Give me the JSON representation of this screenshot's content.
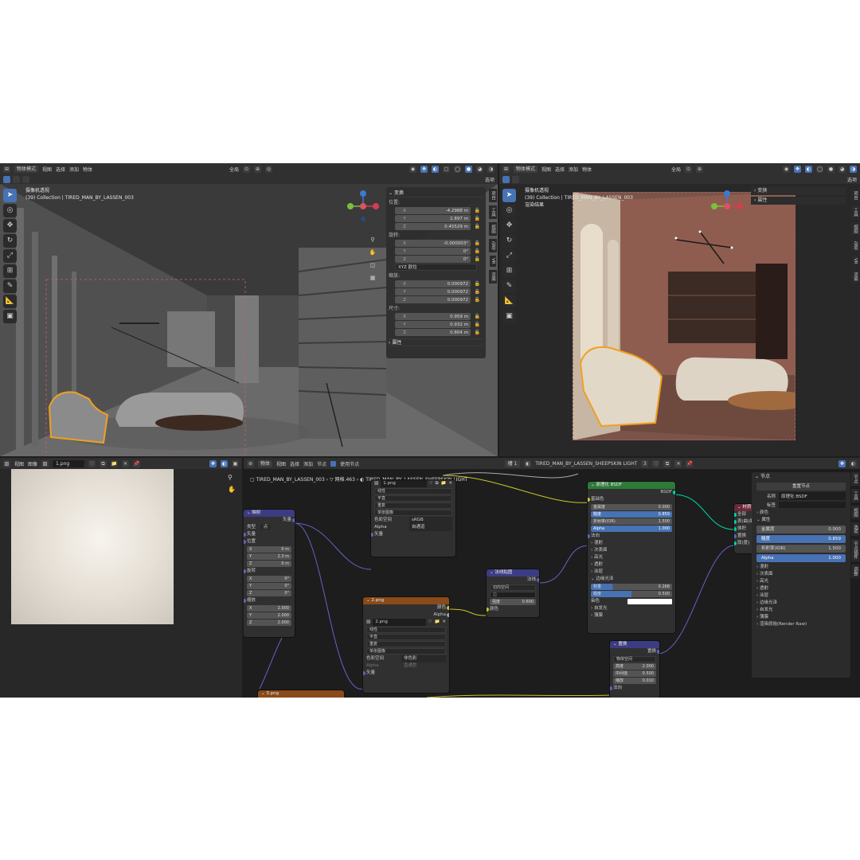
{
  "left_viewport": {
    "header": {
      "mode": "物体模式",
      "menus": [
        "视图",
        "选择",
        "添加",
        "物体"
      ],
      "transform_global": "全局",
      "options": "选项"
    },
    "info_line1": "摄像机透视",
    "info_line2": "(39) Collection | TIRED_MAN_BY_LASSEN_003"
  },
  "transform_panel": {
    "title": "变换",
    "location_label": "位置:",
    "location": [
      {
        "k": "X",
        "v": "-4.2988 m"
      },
      {
        "k": "Y",
        "v": "2.897 m"
      },
      {
        "k": "Z",
        "v": "0.45529 m"
      }
    ],
    "rotation_label": "旋转:",
    "rotation": [
      {
        "k": "X",
        "v": "-0.000003°"
      },
      {
        "k": "Y",
        "v": "0°"
      },
      {
        "k": "Z",
        "v": "0°"
      }
    ],
    "rotation_mode": "XYZ 欧拉",
    "scale_label": "缩放:",
    "scale": [
      {
        "k": "X",
        "v": "0.000972"
      },
      {
        "k": "Y",
        "v": "0.000972"
      },
      {
        "k": "Z",
        "v": "0.000972"
      }
    ],
    "dimensions_label": "尺寸:",
    "dimensions": [
      {
        "k": "X",
        "v": "0.959 m"
      },
      {
        "k": "Y",
        "v": "0.932 m"
      },
      {
        "k": "Z",
        "v": "0.804 m"
      }
    ],
    "properties": "属性"
  },
  "left_vtabs": [
    "项目",
    "工具",
    "视图",
    "杂项",
    "VR",
    "渲染"
  ],
  "right_viewport": {
    "header": {
      "mode": "物体模式",
      "menus": [
        "视图",
        "选择",
        "添加",
        "物体"
      ],
      "transform_global": "全局",
      "options": "选项"
    },
    "info_line1": "摄像机透视",
    "info_line2": "(39) Collection | TIRED_MAN_BY_LASSEN_003",
    "info_line3": "渲染结果",
    "panel_items": [
      "变换",
      "属性"
    ]
  },
  "right_vtabs": [
    "项目",
    "工具",
    "视图",
    "杂项",
    "VR",
    "渲染"
  ],
  "image_editor": {
    "menus": [
      "视图",
      "图像"
    ],
    "image_name": "1.png"
  },
  "node_editor": {
    "header": {
      "mode": "物体",
      "menus": [
        "视图",
        "选择",
        "添加",
        "节点"
      ],
      "use_nodes": "使用节点",
      "slot": "槽 1",
      "material": "TIRED_MAN_BY_LASSEN_SHEEPSKIN LIGHT",
      "users": "3"
    },
    "breadcrumb": [
      "TIRED_MAN_BY_LASSEN_003",
      "网格.463",
      "TIRED_MAN_BY_LASSEN_SHEEPSKIN LIGHT"
    ]
  },
  "mapping_node": {
    "title": "映射",
    "out": "矢量",
    "type_label": "类型",
    "type_value": "点",
    "vector": "矢量",
    "loc": "位置",
    "locs": [
      {
        "k": "X",
        "v": "0 m"
      },
      {
        "k": "Y",
        "v": "2.3 m"
      },
      {
        "k": "Z",
        "v": "0 m"
      }
    ],
    "rot": "旋转",
    "rots": [
      {
        "k": "X",
        "v": "0°"
      },
      {
        "k": "Y",
        "v": "0°"
      },
      {
        "k": "Z",
        "v": "0°"
      }
    ],
    "scl": "缩放",
    "scls": [
      {
        "k": "X",
        "v": "2.000"
      },
      {
        "k": "Y",
        "v": "2.000"
      },
      {
        "k": "Z",
        "v": "2.000"
      }
    ]
  },
  "image_node1": {
    "image": "1.png",
    "opts": [
      "线性",
      "平直",
      "重复",
      "单张图像"
    ],
    "cs_label": "色彩空间",
    "cs_value": "sRGB",
    "alpha_label": "Alpha",
    "alpha_value": "自通道",
    "vector": "矢量"
  },
  "image_node2": {
    "title": "2.png",
    "out1": "颜色",
    "out2": "Alpha",
    "image": "2.png",
    "opts": [
      "线性",
      "平直",
      "重复",
      "单张图像"
    ],
    "cs_label": "色彩空间",
    "cs_value": "非色彩",
    "alpha_label": "Alpha",
    "alpha_value": "直通型",
    "vector": "矢量"
  },
  "image_node3": {
    "title": "3.png"
  },
  "normal_node": {
    "title": "法线贴图",
    "out": "法线",
    "space": "切向空间",
    "strength_label": "强度",
    "strength_value": "0.600",
    "color": "颜色"
  },
  "bsdf_node": {
    "title": "原理化 BSDF",
    "out": "BSDF",
    "base_color": "基础色",
    "rows": [
      {
        "k": "金属度",
        "v": "0.000",
        "blue": false
      },
      {
        "k": "糙度",
        "v": "0.859",
        "blue": true
      },
      {
        "k": "折射率(IOR)",
        "v": "1.500",
        "blue": false
      },
      {
        "k": "Alpha",
        "v": "1.000",
        "blue": true
      }
    ],
    "normal": "法向",
    "sections": [
      "漫射",
      "次表面",
      "高光",
      "透射",
      "涂层"
    ],
    "sheen": "边缘光泽",
    "sheen_rows": [
      {
        "k": "权重",
        "v": "0.268"
      },
      {
        "k": "糙度",
        "v": "0.500"
      }
    ],
    "tint": "染色",
    "sections2": [
      "自发光",
      "薄膜"
    ]
  },
  "bump_node": {
    "title": "置换",
    "out": "置换",
    "space": "物体空间",
    "rows": [
      {
        "k": "高度",
        "v": "2.000"
      },
      {
        "k": "中间值",
        "v": "0.500"
      },
      {
        "k": "缩放",
        "v": "0.010"
      }
    ],
    "normal": "法向"
  },
  "output_node": {
    "title": "材质",
    "rows": [
      "全部",
      "表(曲)面",
      "体积",
      "置换",
      "厚(度)"
    ]
  },
  "side_panel": {
    "title": "节点",
    "reset": "重置节点",
    "name_label": "名称",
    "name_value": "原理化 BSDF",
    "label_label": "标签",
    "color": "颜色",
    "props": "属性",
    "rows": [
      {
        "k": "金属度",
        "v": "0.000",
        "blue": false
      },
      {
        "k": "糙度",
        "v": "0.859",
        "blue": true
      },
      {
        "k": "折射率(IOR)",
        "v": "1.500",
        "blue": false
      },
      {
        "k": "Alpha",
        "v": "1.000",
        "blue": true
      }
    ],
    "sections": [
      "漫射",
      "次表面",
      "高光",
      "透射",
      "涂层",
      "边缘光泽",
      "自发光",
      "薄膜"
    ],
    "bake": "渲染原始(Render Raw)"
  },
  "node_vtabs": [
    "节点",
    "工具",
    "视图",
    "选项",
    "节点插件",
    "调整"
  ]
}
